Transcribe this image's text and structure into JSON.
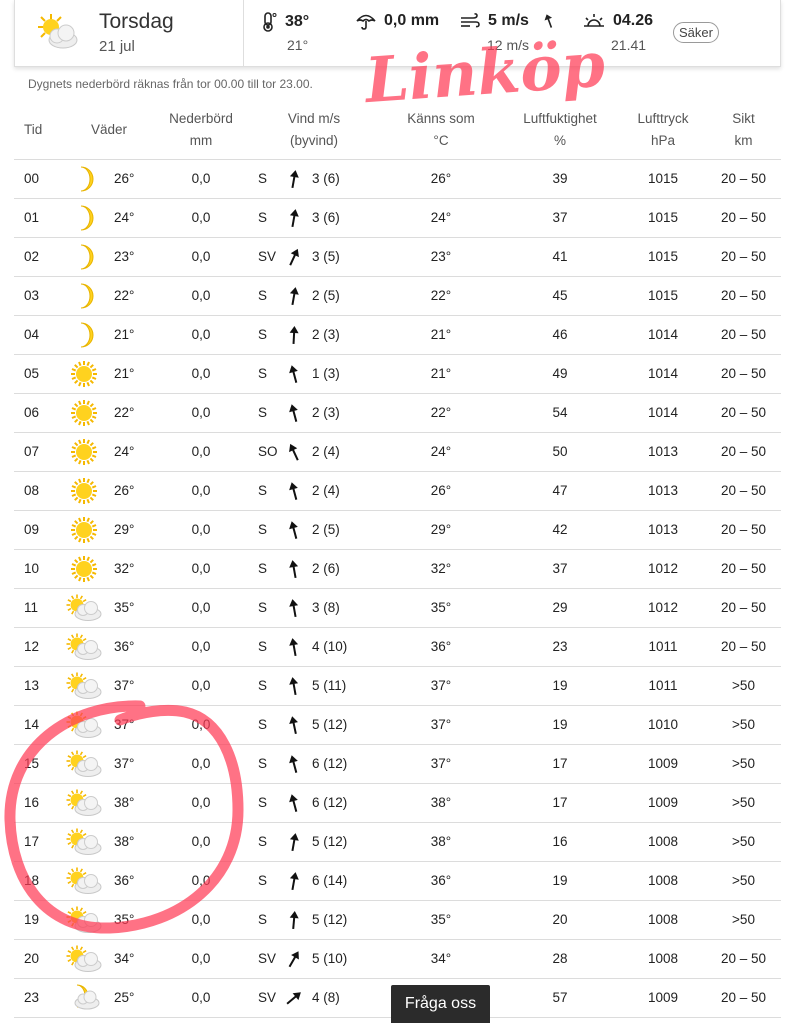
{
  "summary": {
    "day": "Torsdag",
    "date": "21 jul",
    "temp_max": "38°",
    "temp_min": "21°",
    "precipitation": "0,0 mm",
    "wind": "5 m/s",
    "gust": "12 m/s",
    "sunrise": "04.26",
    "sunset": "21.41",
    "badge": "Säker"
  },
  "note": "Dygnets nederbörd räknas från tor 00.00 till tor 23.00.",
  "headers": {
    "time": "Tid",
    "weather": "Väder",
    "precip": "Nederbörd",
    "precip_unit": "mm",
    "wind": "Vind m/s",
    "wind_unit": "(byvind)",
    "feels": "Känns som",
    "feels_unit": "°C",
    "humidity": "Luftfuktighet",
    "humidity_unit": "%",
    "pressure": "Lufttryck",
    "pressure_unit": "hPa",
    "visibility": "Sikt",
    "visibility_unit": "km"
  },
  "rows": [
    {
      "time": "00",
      "icon": "moon-icon",
      "temp": "26°",
      "precip": "0,0",
      "dir": "S",
      "deg": 10,
      "wind": "3 (6)",
      "feels": "26°",
      "hum": "39",
      "pres": "1015",
      "vis": "20 – 50"
    },
    {
      "time": "01",
      "icon": "moon-icon",
      "temp": "24°",
      "precip": "0,0",
      "dir": "S",
      "deg": 10,
      "wind": "3 (6)",
      "feels": "24°",
      "hum": "37",
      "pres": "1015",
      "vis": "20 – 50"
    },
    {
      "time": "02",
      "icon": "moon-icon",
      "temp": "23°",
      "precip": "0,0",
      "dir": "SV",
      "deg": 25,
      "wind": "3 (5)",
      "feels": "23°",
      "hum": "41",
      "pres": "1015",
      "vis": "20 – 50"
    },
    {
      "time": "03",
      "icon": "moon-icon",
      "temp": "22°",
      "precip": "0,0",
      "dir": "S",
      "deg": 10,
      "wind": "2 (5)",
      "feels": "22°",
      "hum": "45",
      "pres": "1015",
      "vis": "20 – 50"
    },
    {
      "time": "04",
      "icon": "moon-icon",
      "temp": "21°",
      "precip": "0,0",
      "dir": "S",
      "deg": 3,
      "wind": "2 (3)",
      "feels": "21°",
      "hum": "46",
      "pres": "1014",
      "vis": "20 – 50"
    },
    {
      "time": "05",
      "icon": "sun-icon",
      "temp": "21°",
      "precip": "0,0",
      "dir": "S",
      "deg": -15,
      "wind": "1 (3)",
      "feels": "21°",
      "hum": "49",
      "pres": "1014",
      "vis": "20 – 50"
    },
    {
      "time": "06",
      "icon": "sun-icon",
      "temp": "22°",
      "precip": "0,0",
      "dir": "S",
      "deg": -15,
      "wind": "2 (3)",
      "feels": "22°",
      "hum": "54",
      "pres": "1014",
      "vis": "20 – 50"
    },
    {
      "time": "07",
      "icon": "sun-icon",
      "temp": "24°",
      "precip": "0,0",
      "dir": "SO",
      "deg": -25,
      "wind": "2 (4)",
      "feels": "24°",
      "hum": "50",
      "pres": "1013",
      "vis": "20 – 50"
    },
    {
      "time": "08",
      "icon": "sun-icon",
      "temp": "26°",
      "precip": "0,0",
      "dir": "S",
      "deg": -15,
      "wind": "2 (4)",
      "feels": "26°",
      "hum": "47",
      "pres": "1013",
      "vis": "20 – 50"
    },
    {
      "time": "09",
      "icon": "sun-icon",
      "temp": "29°",
      "precip": "0,0",
      "dir": "S",
      "deg": -15,
      "wind": "2 (5)",
      "feels": "29°",
      "hum": "42",
      "pres": "1013",
      "vis": "20 – 50"
    },
    {
      "time": "10",
      "icon": "sun-icon",
      "temp": "32°",
      "precip": "0,0",
      "dir": "S",
      "deg": -10,
      "wind": "2 (6)",
      "feels": "32°",
      "hum": "37",
      "pres": "1012",
      "vis": "20 – 50"
    },
    {
      "time": "11",
      "icon": "partly-cloudy-icon",
      "temp": "35°",
      "precip": "0,0",
      "dir": "S",
      "deg": -10,
      "wind": "3 (8)",
      "feels": "35°",
      "hum": "29",
      "pres": "1012",
      "vis": "20 – 50"
    },
    {
      "time": "12",
      "icon": "partly-cloudy-icon",
      "temp": "36°",
      "precip": "0,0",
      "dir": "S",
      "deg": -10,
      "wind": "4 (10)",
      "feels": "36°",
      "hum": "23",
      "pres": "1011",
      "vis": "20 – 50"
    },
    {
      "time": "13",
      "icon": "partly-cloudy-icon",
      "temp": "37°",
      "precip": "0,0",
      "dir": "S",
      "deg": -10,
      "wind": "5 (11)",
      "feels": "37°",
      "hum": "19",
      "pres": "1011",
      "vis": ">50"
    },
    {
      "time": "14",
      "icon": "partly-cloudy-icon",
      "temp": "37°",
      "precip": "0,0",
      "dir": "S",
      "deg": -12,
      "wind": "5 (12)",
      "feels": "37°",
      "hum": "19",
      "pres": "1010",
      "vis": ">50"
    },
    {
      "time": "15",
      "icon": "partly-cloudy-icon",
      "temp": "37°",
      "precip": "0,0",
      "dir": "S",
      "deg": -15,
      "wind": "6 (12)",
      "feels": "37°",
      "hum": "17",
      "pres": "1009",
      "vis": ">50"
    },
    {
      "time": "16",
      "icon": "partly-cloudy-icon",
      "temp": "38°",
      "precip": "0,0",
      "dir": "S",
      "deg": -15,
      "wind": "6 (12)",
      "feels": "38°",
      "hum": "17",
      "pres": "1009",
      "vis": ">50"
    },
    {
      "time": "17",
      "icon": "partly-cloudy-icon",
      "temp": "38°",
      "precip": "0,0",
      "dir": "S",
      "deg": 10,
      "wind": "5 (12)",
      "feels": "38°",
      "hum": "16",
      "pres": "1008",
      "vis": ">50"
    },
    {
      "time": "18",
      "icon": "partly-cloudy-icon",
      "temp": "36°",
      "precip": "0,0",
      "dir": "S",
      "deg": 10,
      "wind": "6 (14)",
      "feels": "36°",
      "hum": "19",
      "pres": "1008",
      "vis": ">50"
    },
    {
      "time": "19",
      "icon": "partly-cloudy-icon",
      "temp": "35°",
      "precip": "0,0",
      "dir": "S",
      "deg": 5,
      "wind": "5 (12)",
      "feels": "35°",
      "hum": "20",
      "pres": "1008",
      "vis": ">50"
    },
    {
      "time": "20",
      "icon": "partly-cloudy-icon",
      "temp": "34°",
      "precip": "0,0",
      "dir": "SV",
      "deg": 30,
      "wind": "5 (10)",
      "feels": "34°",
      "hum": "28",
      "pres": "1008",
      "vis": "20 – 50"
    },
    {
      "time": "23",
      "icon": "moon-cloud-icon",
      "temp": "25°",
      "precip": "0,0",
      "dir": "SV",
      "deg": 50,
      "wind": "4 (8)",
      "feels": "",
      "hum": "57",
      "pres": "1009",
      "vis": "20 – 50"
    }
  ],
  "handwriting": "Linköp",
  "chat_button": "Fråga oss"
}
